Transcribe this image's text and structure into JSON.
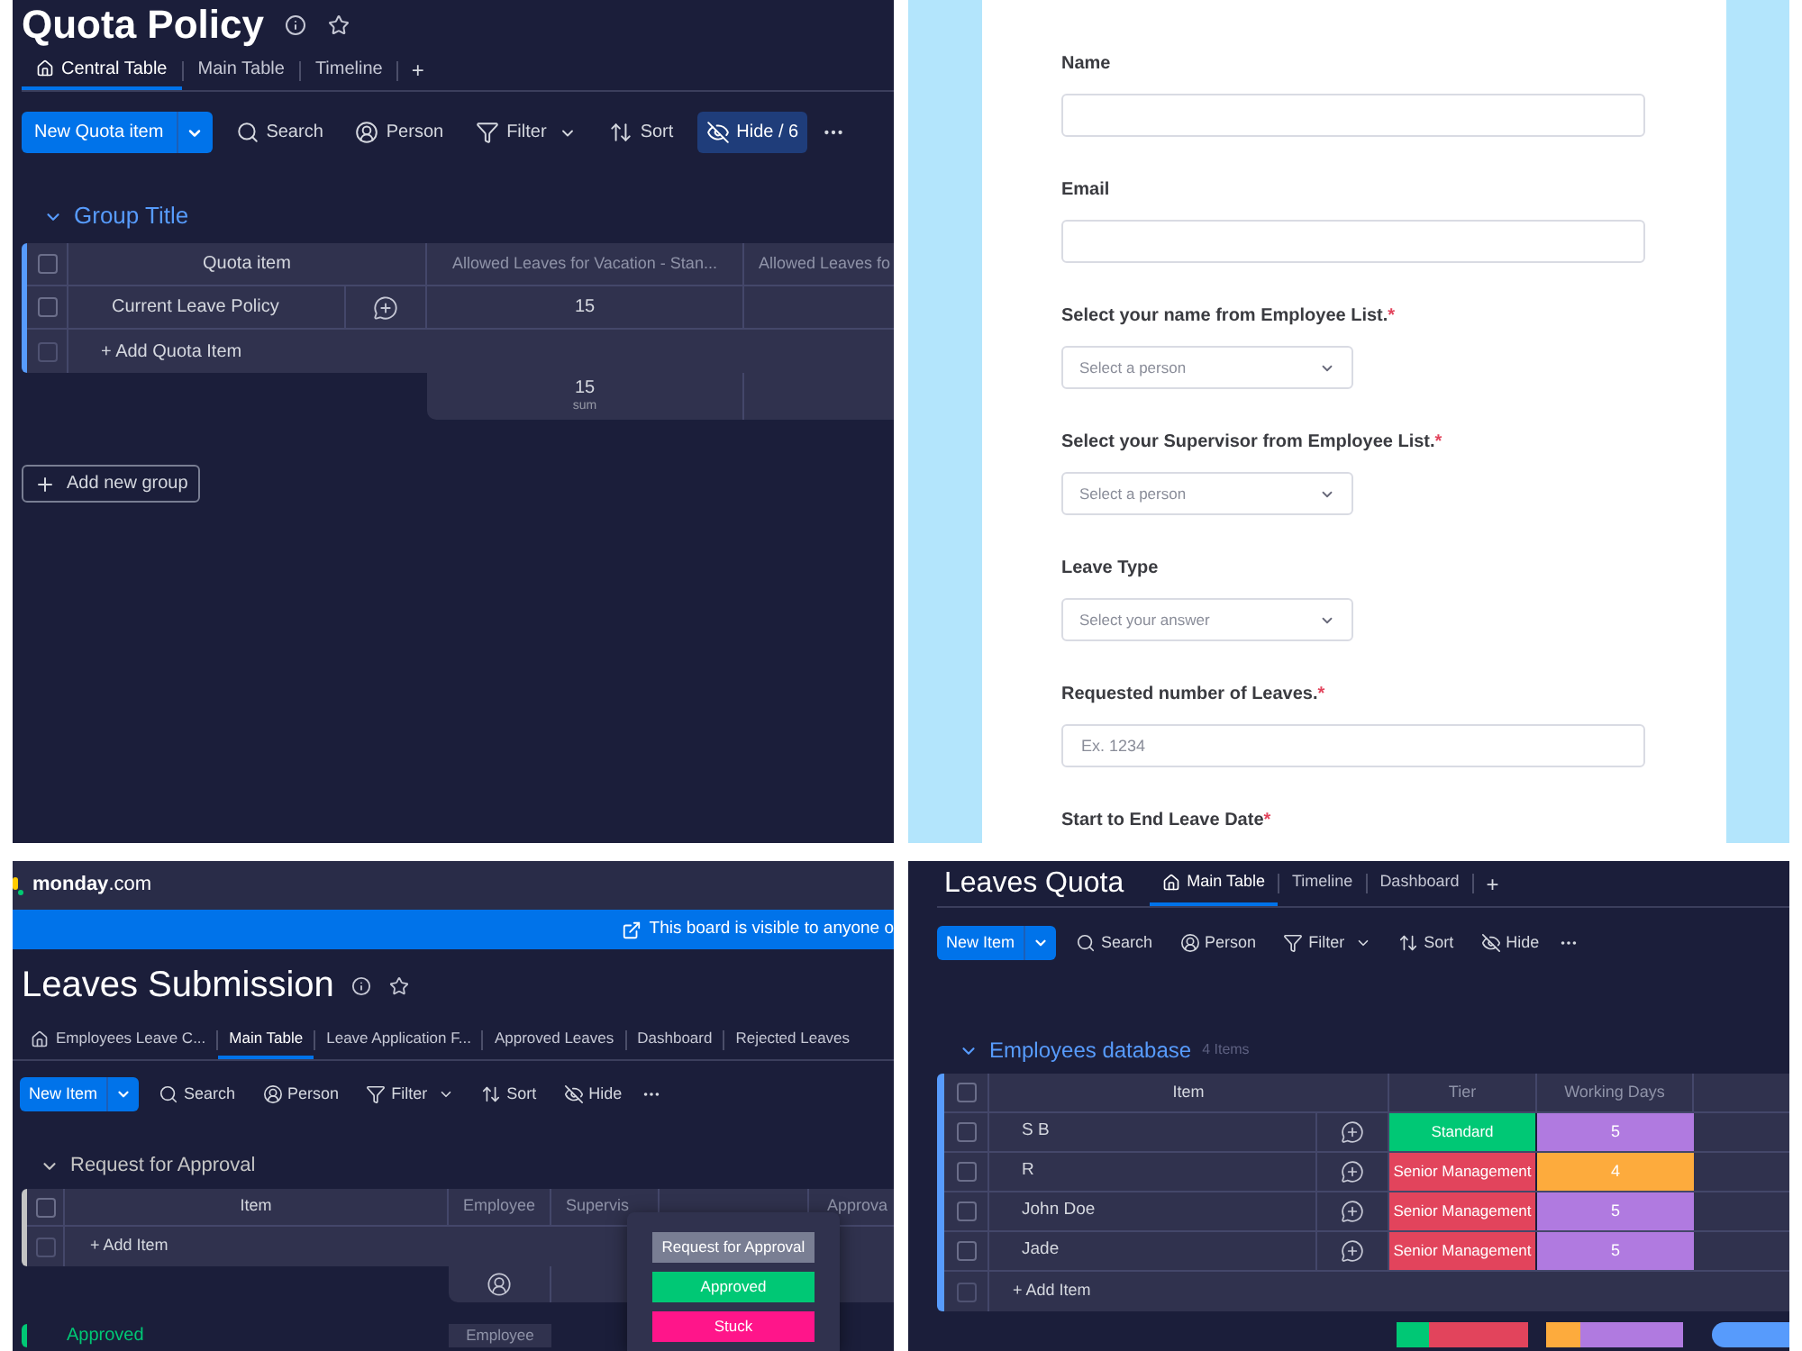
{
  "quota_policy": {
    "title": "Quota Policy",
    "tabs": [
      {
        "label": "Central Table",
        "home": true,
        "selected": true
      },
      {
        "label": "Main Table",
        "selected": false
      },
      {
        "label": "Timeline",
        "selected": false
      }
    ],
    "add_view": "+",
    "toolbar": {
      "new_button": "New Quota item",
      "items": [
        {
          "kind": "search",
          "label": "Search",
          "active": false
        },
        {
          "kind": "person",
          "label": "Person",
          "active": false
        },
        {
          "kind": "filter",
          "label": "Filter",
          "active": false
        },
        {
          "kind": "sort",
          "label": "Sort",
          "active": false
        },
        {
          "kind": "hide",
          "label": "Hide / 6",
          "active": true
        }
      ]
    },
    "group": {
      "title": "Group Title",
      "color": "#579bfc",
      "expanded": true
    },
    "table": {
      "select_all_checked": false,
      "columns": [
        "Quota item",
        "Allowed Leaves for Vacation - Stan...",
        "Allowed Leaves fo"
      ],
      "rows": [
        {
          "item": "Current Leave Policy",
          "checked": false,
          "values": [
            "15"
          ]
        }
      ],
      "add_item": "+ Add Quota Item",
      "add_row_checked": false,
      "summary": {
        "value": "15",
        "label": "sum"
      }
    },
    "add_group": "Add new group"
  },
  "form": {
    "fields": [
      {
        "kind": "text",
        "label": "Name"
      },
      {
        "kind": "text",
        "label": "Email"
      },
      {
        "kind": "select",
        "label": "Select your name from Employee List.",
        "required_mark": "*",
        "placeholder": "Select a person"
      },
      {
        "kind": "select",
        "label": "Select your Supervisor from Employee List.",
        "required_mark": "*",
        "placeholder": "Select a person"
      },
      {
        "kind": "select",
        "label": "Leave Type",
        "placeholder": "Select your answer"
      },
      {
        "kind": "text",
        "label": "Requested number of Leaves.",
        "required_mark": "*",
        "placeholder": "Ex. 1234"
      },
      {
        "kind": "date",
        "label": "Start to End Leave Date",
        "required_mark": "*"
      }
    ]
  },
  "leaves_submission": {
    "logo": "**monday**.com",
    "banner": "This board is visible to anyone o",
    "title": "Leaves Submission",
    "tabs": [
      {
        "label": "Employees Leave C...",
        "home": true,
        "selected": false
      },
      {
        "label": "Main Table",
        "selected": true
      },
      {
        "label": "Leave Application F...",
        "selected": false
      },
      {
        "label": "Approved Leaves",
        "selected": false
      },
      {
        "label": "Dashboard",
        "selected": false
      },
      {
        "label": "Rejected Leaves",
        "selected": false
      }
    ],
    "toolbar": {
      "new_button": "New Item",
      "items": [
        {
          "kind": "search",
          "label": "Search"
        },
        {
          "kind": "person",
          "label": "Person"
        },
        {
          "kind": "filter",
          "label": "Filter"
        },
        {
          "kind": "sort",
          "label": "Sort"
        },
        {
          "kind": "hide",
          "label": "Hide"
        }
      ]
    },
    "group": {
      "title": "Request for Approval",
      "color": "#c4c4c4",
      "expanded": true
    },
    "table": {
      "select_all_checked": false,
      "columns": [
        "Item",
        "Employee",
        "Supervis",
        "Approva"
      ],
      "add_item": "+ Add Item",
      "add_row_checked": false
    },
    "status_menu": {
      "options": [
        {
          "label": "Request for Approval",
          "color": "#797e93"
        },
        {
          "label": "Approved",
          "color": "#00c875"
        },
        {
          "label": "Stuck",
          "color": "#ff158a"
        }
      ]
    },
    "next_group": {
      "title": "Approved",
      "color": "#00c875",
      "columns": [
        "Employee"
      ]
    }
  },
  "leaves_quota": {
    "title": "Leaves Quota",
    "tabs": [
      {
        "label": "Main Table",
        "home": true,
        "selected": true
      },
      {
        "label": "Timeline",
        "selected": false
      },
      {
        "label": "Dashboard",
        "selected": false
      }
    ],
    "add_view": "+",
    "toolbar": {
      "new_button": "New Item",
      "items": [
        {
          "kind": "search",
          "label": "Search"
        },
        {
          "kind": "person",
          "label": "Person"
        },
        {
          "kind": "filter",
          "label": "Filter"
        },
        {
          "kind": "sort",
          "label": "Sort"
        },
        {
          "kind": "hide",
          "label": "Hide"
        }
      ]
    },
    "group": {
      "title": "Employees database",
      "count": "4 Items",
      "color": "#579bfc",
      "expanded": true
    },
    "table": {
      "select_all_checked": false,
      "columns": [
        "Item",
        "Tier",
        "Working Days"
      ],
      "rows": [
        {
          "item": "S B",
          "checked": false,
          "tier": {
            "label": "Standard",
            "color": "#00c875"
          },
          "working_days": {
            "label": "5",
            "color": "#b07ae0"
          }
        },
        {
          "item": "R",
          "checked": false,
          "tier": {
            "label": "Senior Management",
            "color": "#e2445c"
          },
          "working_days": {
            "label": "4",
            "color": "#fdab3d"
          }
        },
        {
          "item": "John Doe",
          "checked": false,
          "tier": {
            "label": "Senior Management",
            "color": "#e2445c"
          },
          "working_days": {
            "label": "5",
            "color": "#b07ae0"
          }
        },
        {
          "item": "Jade",
          "checked": false,
          "tier": {
            "label": "Senior Management",
            "color": "#e2445c"
          },
          "working_days": {
            "label": "5",
            "color": "#b07ae0"
          }
        }
      ],
      "add_item": "+ Add Item",
      "add_row_checked": false
    }
  }
}
